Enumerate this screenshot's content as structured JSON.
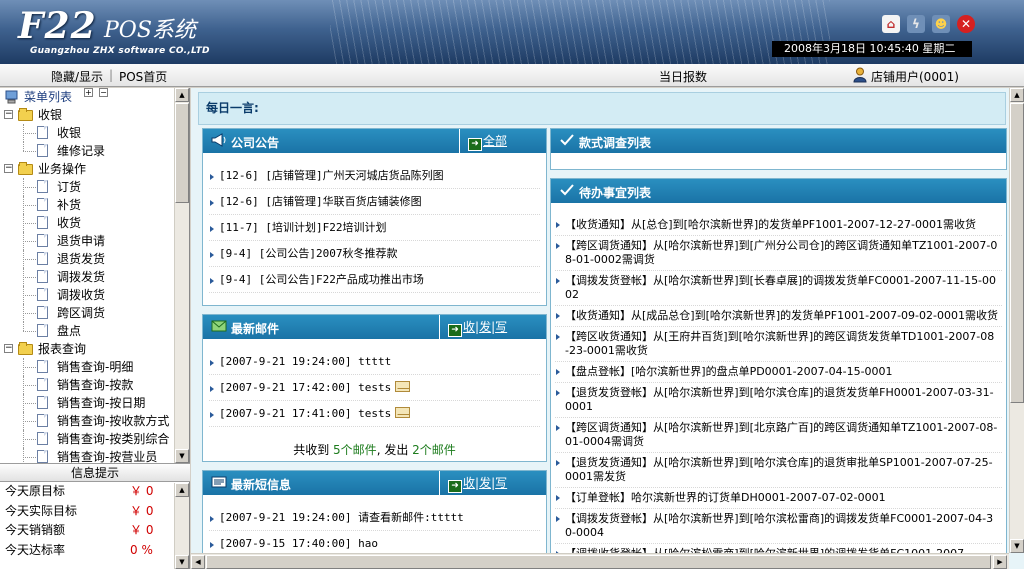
{
  "header": {
    "logo_main": "F22",
    "logo_sub": "POS系统",
    "company": "Guangzhou ZHX software CO.,LTD",
    "datetime": "2008年3月18日 10:45:40 星期二",
    "icons": [
      "home-icon",
      "flash-icon",
      "users-icon",
      "close-icon"
    ]
  },
  "toolbar": {
    "toggle": "隐藏/显示",
    "separator": "|",
    "home": "POS首页",
    "report": "当日报数",
    "user": "店铺用户(0001)"
  },
  "menu": {
    "title": "菜单列表",
    "expand_all": "+",
    "collapse_all": "−",
    "categories": [
      {
        "label": "收银",
        "items": [
          "收银",
          "维修记录"
        ]
      },
      {
        "label": "业务操作",
        "items": [
          "订货",
          "补货",
          "收货",
          "退货申请",
          "退货发货",
          "调拨发货",
          "调拨收货",
          "跨区调货",
          "盘点"
        ]
      },
      {
        "label": "报表查询",
        "items": [
          "销售查询-明细",
          "销售查询-按款",
          "销售查询-按日期",
          "销售查询-按收款方式",
          "销售查询-按类别综合",
          "销售查询-按营业员"
        ]
      }
    ]
  },
  "info": {
    "title": "信息提示",
    "rows": [
      {
        "label": "今天原目标",
        "value": "￥ 0"
      },
      {
        "label": "今天实际目标",
        "value": "￥ 0"
      },
      {
        "label": "今天销销额",
        "value": "￥ 0"
      },
      {
        "label": "今天达标率",
        "value": "0 %"
      }
    ]
  },
  "main": {
    "motto": "每日一言:",
    "announcements": {
      "title": "公司公告",
      "all_label": "全部",
      "items": [
        "[12-6] [店铺管理]广州天河城店货品陈列图",
        "[12-6] [店铺管理]华联百货店铺装修图",
        "[11-7] [培训计划]F22培训计划",
        "[9-4] [公司公告]2007秋冬推荐款",
        "[9-4] [公司公告]F22产品成功推出市场"
      ]
    },
    "mail": {
      "title": "最新邮件",
      "actions": [
        "收",
        "发",
        "写"
      ],
      "items": [
        {
          "time": "[2007-9-21 19:24:00]",
          "text": "ttttt",
          "has_icon": false
        },
        {
          "time": "[2007-9-21 17:42:00]",
          "text": "tests",
          "has_icon": true
        },
        {
          "time": "[2007-9-21 17:41:00]",
          "text": "tests",
          "has_icon": true
        }
      ],
      "summary_prefix": "共收到",
      "received": "5个邮件",
      "summary_mid": ", 发出",
      "sent": "2个邮件"
    },
    "sms": {
      "title": "最新短信息",
      "actions": [
        "收",
        "发",
        "写"
      ],
      "items": [
        "[2007-9-21 19:24:00] 请查看新邮件:ttttt",
        "[2007-9-15 17:40:00] hao"
      ]
    },
    "survey": {
      "title": "款式调查列表"
    },
    "todo": {
      "title": "待办事宜列表",
      "items": [
        "【收货通知】从[总仓]到[哈尔滨新世界]的发货单PF1001-2007-12-27-0001需收货",
        "【跨区调货通知】从[哈尔滨新世界]到[广州分公司仓]的跨区调货通知单TZ1001-2007-08-01-0002需调货",
        "【调拨发货登帐】从[哈尔滨新世界]到[长春卓展]的调拨发货单FC0001-2007-11-15-0002",
        "【收货通知】从[成品总仓]到[哈尔滨新世界]的发货单PF1001-2007-09-02-0001需收货",
        "【跨区收货通知】从[王府井百货]到[哈尔滨新世界]的跨区调货发货单TD1001-2007-08-23-0001需收货",
        "【盘点登帐】[哈尔滨新世界]的盘点单PD0001-2007-04-15-0001",
        "【退货发货登帐】从[哈尔滨新世界]到[哈尔滨仓库]的退货发货单FH0001-2007-03-31-0001",
        "【跨区调货通知】从[哈尔滨新世界]到[北京路广百]的跨区调货通知单TZ1001-2007-08-01-0004需调货",
        "【退货发货通知】从[哈尔滨新世界]到[哈尔滨仓库]的退货审批单SP1001-2007-07-25-0001需发货",
        "【订单登帐】哈尔滨新世界的订货单DH0001-2007-07-02-0001",
        "【调拨发货登帐】从[哈尔滨新世界]到[哈尔滨松雷商]的调拨发货单FC0001-2007-04-30-0004",
        "【调拨收货登帐】从[哈尔滨松雷商]到[哈尔滨新世界]的调拨发货单FC1001-2007-"
      ]
    }
  }
}
